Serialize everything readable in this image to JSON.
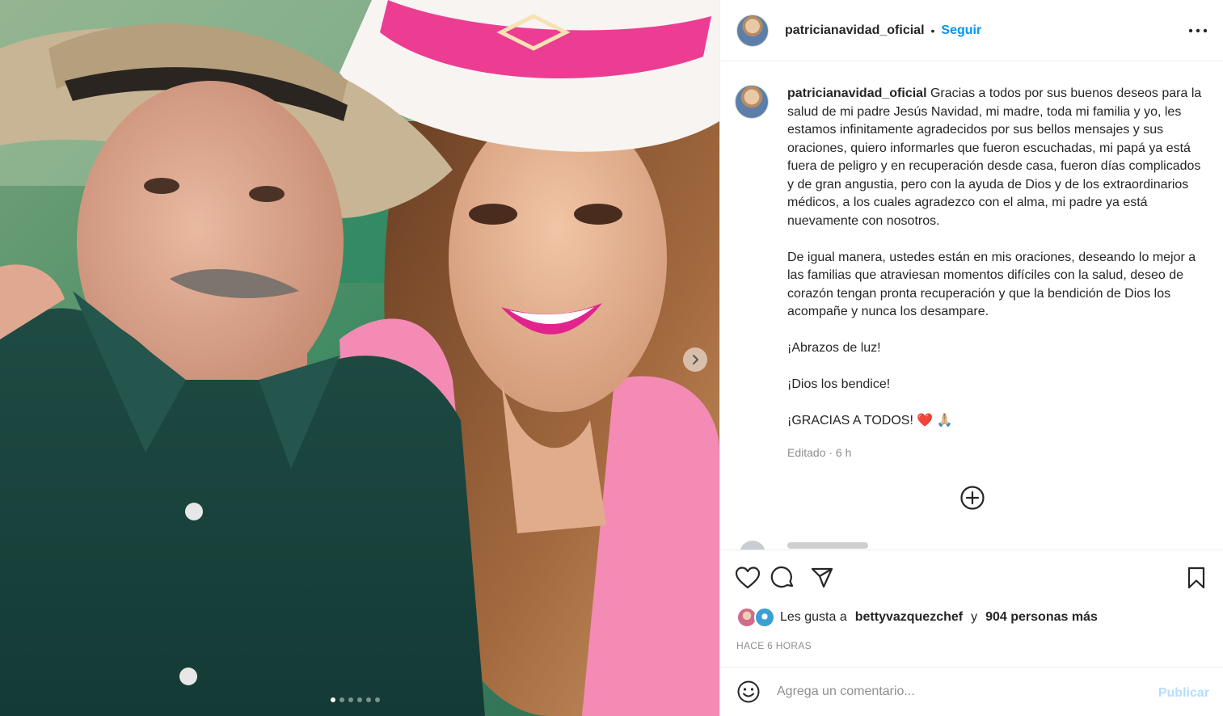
{
  "post": {
    "username": "patricianavidad_oficial",
    "separator": "•",
    "follow_label": "Seguir",
    "more_icon": "more-horizontal-icon"
  },
  "media": {
    "carousel_count": 6,
    "active_index": 0,
    "next_icon": "chevron-right-icon"
  },
  "caption": {
    "username": "patricianavidad_oficial",
    "paragraphs": [
      "Gracias a todos por sus buenos deseos para la salud de mi padre Jesús Navidad, mi madre, toda mi familia y yo, les estamos infinitamente agradecidos por sus bellos mensajes y sus oraciones, quiero informarles que fueron escuchadas, mi papá ya está fuera de peligro y en recuperación desde casa, fueron días complicados y de gran angustia, pero con la ayuda de Dios y de los extraordinarios médicos, a los cuales agradezco con el alma, mi padre ya está nuevamente con nosotros.",
      "De igual manera, ustedes están en mis oraciones, deseando lo mejor a las familias que atraviesan momentos difíciles con la salud, deseo de corazón tengan pronta recuperación y que la bendición de Dios los acompañe y nunca los desampare.",
      "¡Abrazos de luz!",
      "¡Dios los bendice!",
      "¡GRACIAS A TODOS! ❤️ 🙏🏼"
    ],
    "edited": "Editado · 6 h",
    "load_more_icon": "plus-circle-icon"
  },
  "actions": {
    "like_icon": "heart-icon",
    "comment_icon": "comment-icon",
    "share_icon": "send-icon",
    "save_icon": "bookmark-icon"
  },
  "likes": {
    "prefix": "Les gusta a",
    "user": "bettyvazquezchef",
    "conjunction": "y",
    "others": "904 personas más"
  },
  "timestamp": "HACE 6 HORAS",
  "comment_box": {
    "emoji_icon": "smiley-icon",
    "placeholder": "Agrega un comentario...",
    "publish_label": "Publicar"
  }
}
